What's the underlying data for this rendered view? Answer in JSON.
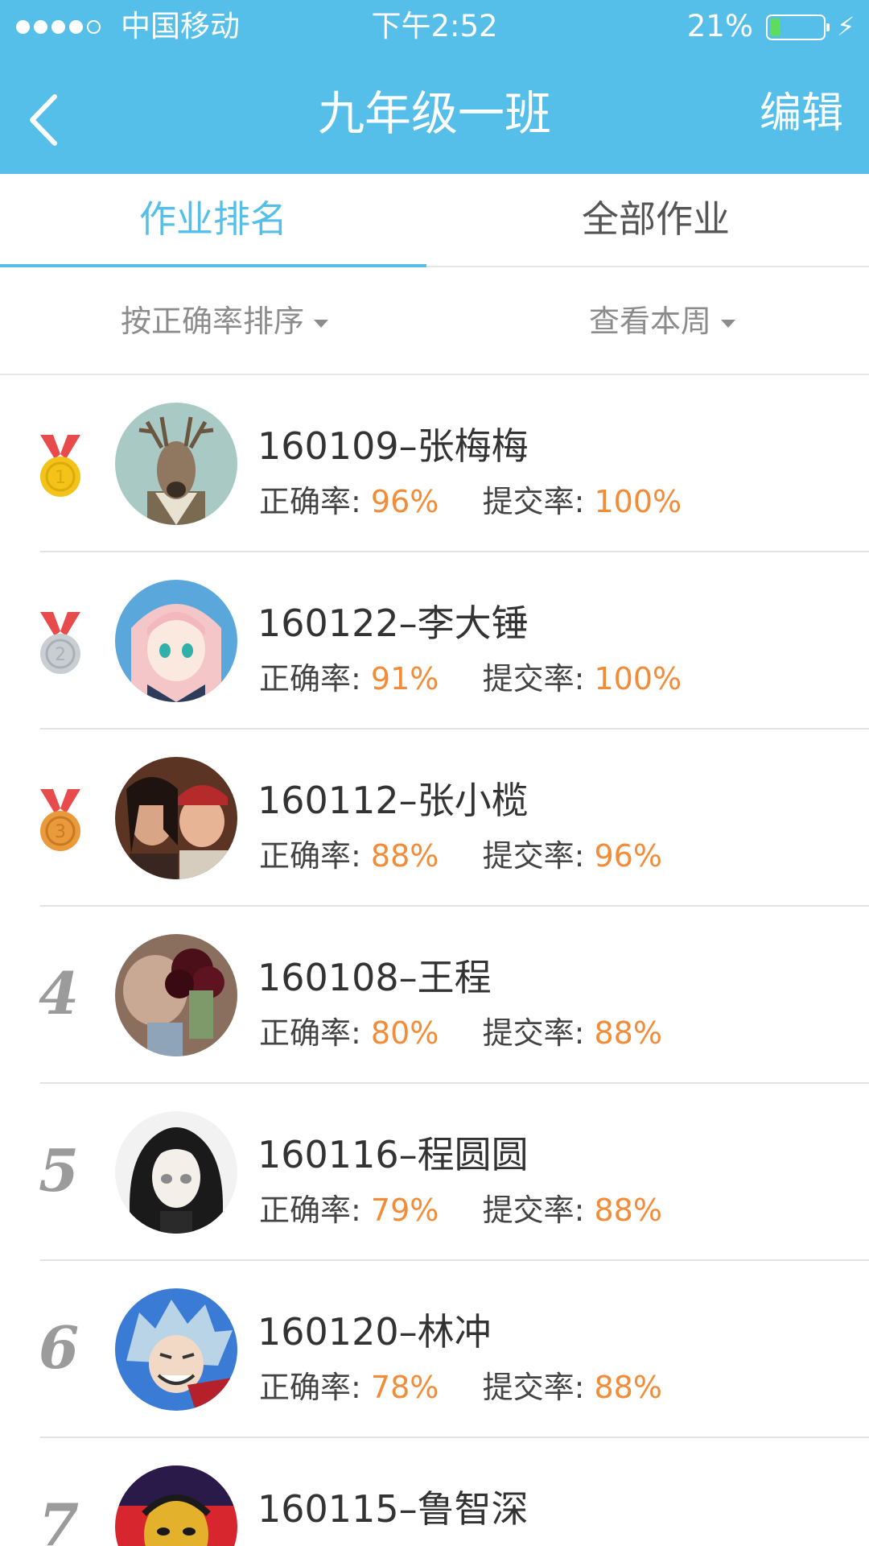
{
  "status_bar": {
    "carrier": "中国移动",
    "time": "下午2:52",
    "battery": "21%",
    "battery_level": 0.21
  },
  "nav": {
    "title": "九年级一班",
    "edit_label": "编辑"
  },
  "tabs": [
    {
      "label": "作业排名",
      "active": true
    },
    {
      "label": "全部作业",
      "active": false
    }
  ],
  "filters": {
    "sort_label": "按正确率排序",
    "period_label": "查看本周"
  },
  "labels": {
    "accuracy": "正确率:",
    "submission": "提交率:"
  },
  "students": [
    {
      "rank": "1",
      "name": "160109–张梅梅",
      "accuracy": "96%",
      "submission": "100%",
      "medal": "gold-medal-icon"
    },
    {
      "rank": "2",
      "name": "160122–李大锤",
      "accuracy": "91%",
      "submission": "100%",
      "medal": "silver-medal-icon"
    },
    {
      "rank": "3",
      "name": "160112–张小榄",
      "accuracy": "88%",
      "submission": "96%",
      "medal": "bronze-medal-icon"
    },
    {
      "rank": "4",
      "name": "160108–王程",
      "accuracy": "80%",
      "submission": "88%"
    },
    {
      "rank": "5",
      "name": "160116–程圆圆",
      "accuracy": "79%",
      "submission": "88%"
    },
    {
      "rank": "6",
      "name": "160120–林冲",
      "accuracy": "78%",
      "submission": "88%"
    },
    {
      "rank": "7",
      "name": "160115–鲁智深"
    }
  ],
  "colors": {
    "header": "#56bfe9",
    "value": "#f28c38",
    "gold": "#f3c31a",
    "silver": "#c9ced3",
    "bronze": "#ea9a3b",
    "ribbon": "#e84b4b"
  }
}
